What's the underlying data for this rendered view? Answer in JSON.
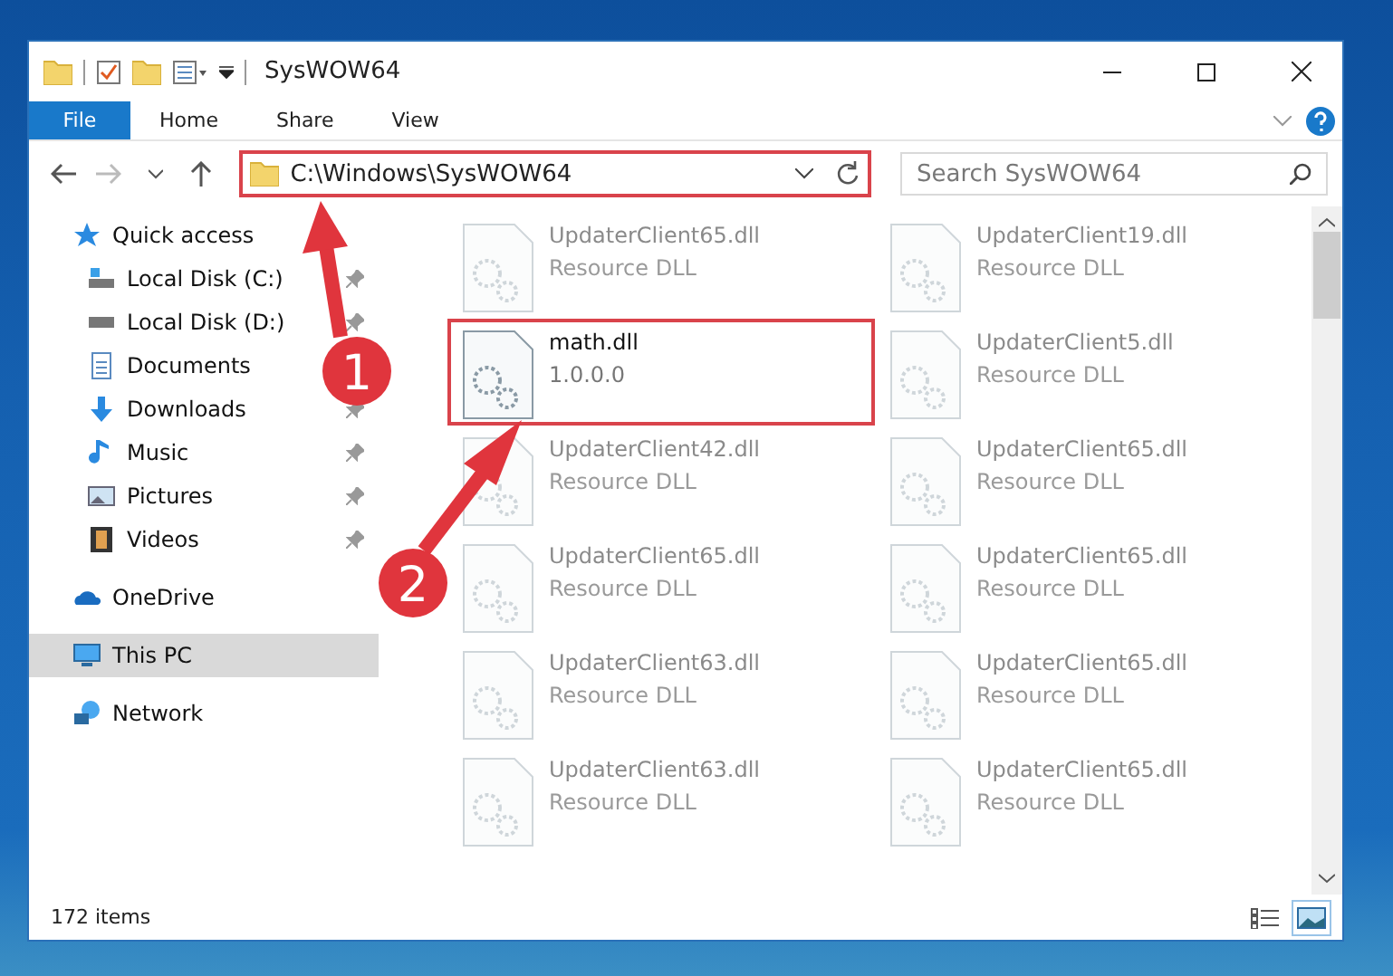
{
  "window": {
    "title": "SysWOW64"
  },
  "ribbon": {
    "tabs": [
      {
        "label": "File",
        "selected": true
      },
      {
        "label": "Home",
        "selected": false
      },
      {
        "label": "Share",
        "selected": false
      },
      {
        "label": "View",
        "selected": false
      }
    ]
  },
  "address": {
    "path": "C:\\Windows\\SysWOW64",
    "annotated": true
  },
  "search": {
    "placeholder": "Search SysWOW64"
  },
  "navigation": [
    {
      "label": "Quick access",
      "selected": false,
      "children": [
        {
          "label": "Local Disk (C:)",
          "pinned": true,
          "selected": false
        },
        {
          "label": "Local Disk (D:)",
          "pinned": true,
          "selected": false
        },
        {
          "label": "Documents",
          "selected": false
        },
        {
          "label": "Downloads",
          "pinned": true,
          "selected": false
        },
        {
          "label": "Music",
          "pinned": true,
          "selected": false
        },
        {
          "label": "Pictures",
          "pinned": true,
          "selected": false
        },
        {
          "label": "Videos",
          "pinned": true,
          "selected": false
        }
      ]
    },
    {
      "label": "OneDrive",
      "selected": false
    },
    {
      "label": "This PC",
      "selected": true
    },
    {
      "label": "Network",
      "selected": false
    }
  ],
  "files": [
    {
      "name": "UpdaterClient65.dll",
      "detail": "Resource DLL",
      "blurred": true,
      "annotated": false
    },
    {
      "name": "UpdaterClient19.dll",
      "detail": "Resource DLL",
      "blurred": true,
      "annotated": false
    },
    {
      "name": "math.dll",
      "detail": "1.0.0.0",
      "blurred": false,
      "annotated": true
    },
    {
      "name": "UpdaterClient5.dll",
      "detail": "Resource DLL",
      "blurred": true,
      "annotated": false
    },
    {
      "name": "UpdaterClient42.dll",
      "detail": "Resource DLL",
      "blurred": true,
      "annotated": false
    },
    {
      "name": "UpdaterClient65.dll",
      "detail": "Resource DLL",
      "blurred": true,
      "annotated": false
    },
    {
      "name": "UpdaterClient65.dll",
      "detail": "Resource DLL",
      "blurred": true,
      "annotated": false
    },
    {
      "name": "UpdaterClient65.dll",
      "detail": "Resource DLL",
      "blurred": true,
      "annotated": false
    },
    {
      "name": "UpdaterClient63.dll",
      "detail": "Resource DLL",
      "blurred": true,
      "annotated": false
    },
    {
      "name": "UpdaterClient65.dll",
      "detail": "Resource DLL",
      "blurred": true,
      "annotated": false
    },
    {
      "name": "UpdaterClient63.dll",
      "detail": "Resource DLL",
      "blurred": true,
      "annotated": false
    },
    {
      "name": "UpdaterClient65.dll",
      "detail": "Resource DLL",
      "blurred": true,
      "annotated": false
    }
  ],
  "status_bar": {
    "count": "172 items",
    "views": [
      {
        "selected": false
      },
      {
        "selected": true
      }
    ]
  },
  "callouts": [
    {
      "number": "1"
    },
    {
      "number": "2"
    }
  ]
}
